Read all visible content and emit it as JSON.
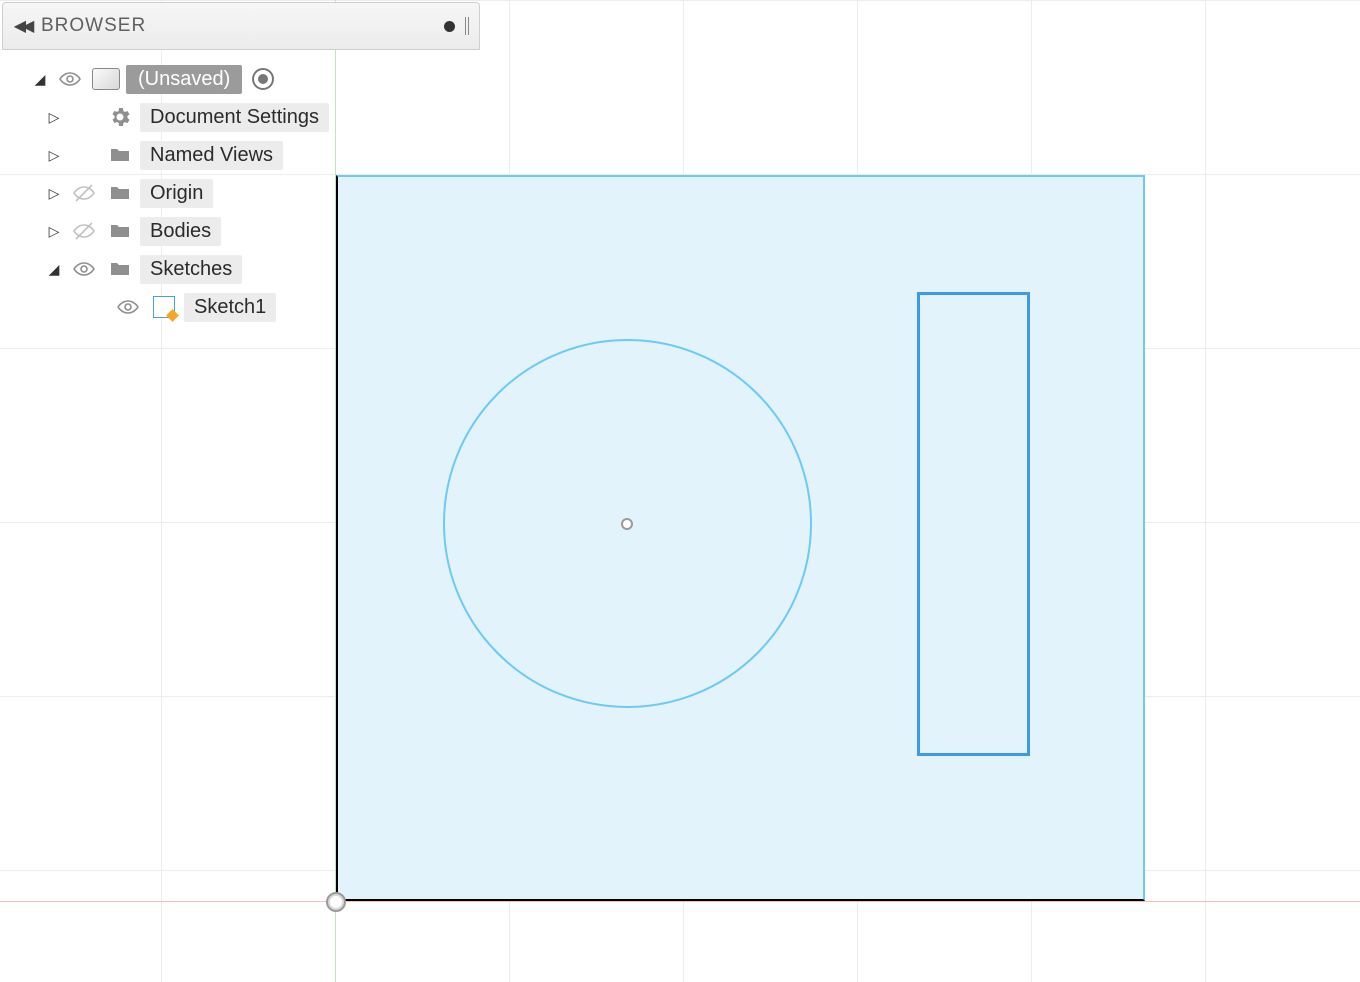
{
  "browser": {
    "title": "BROWSER",
    "root": {
      "label": "(Unsaved)"
    },
    "items": [
      {
        "label": "Document Settings"
      },
      {
        "label": "Named Views"
      },
      {
        "label": "Origin"
      },
      {
        "label": "Bodies"
      },
      {
        "label": "Sketches"
      }
    ],
    "sketch_child": {
      "label": "Sketch1"
    }
  }
}
